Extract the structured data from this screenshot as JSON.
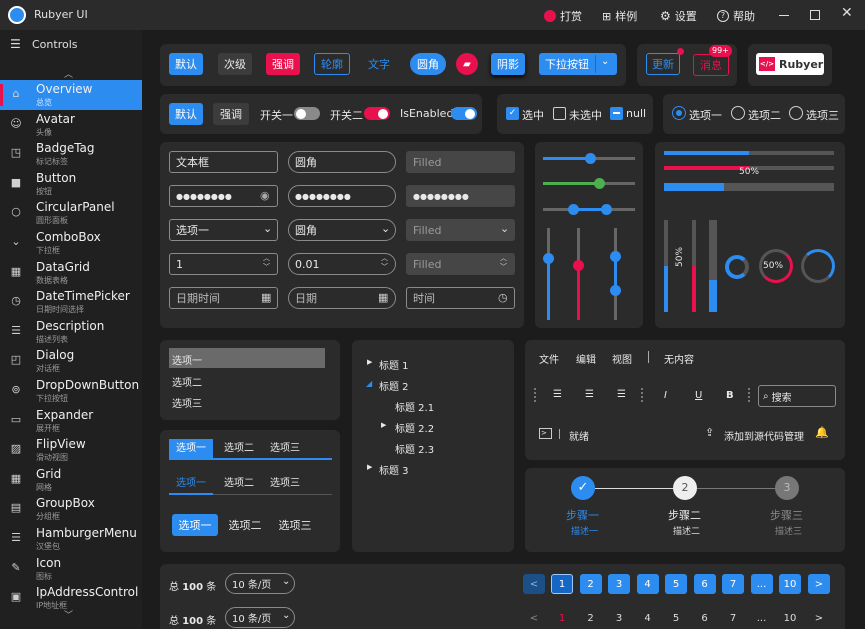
{
  "app": {
    "title": "Rubyer UI"
  },
  "titlebar": {
    "reward": "打赏",
    "samples": "样例",
    "settings": "设置",
    "help": "帮助"
  },
  "sidebar": {
    "header": "Controls",
    "items": [
      {
        "label": "Overview",
        "sub": "总览",
        "icon": "home-icon",
        "glyph": "⌂"
      },
      {
        "label": "Avatar",
        "sub": "头像",
        "icon": "avatar-icon",
        "glyph": "☺"
      },
      {
        "label": "BadgeTag",
        "sub": "标记标签",
        "icon": "badge-icon",
        "glyph": "◳"
      },
      {
        "label": "Button",
        "sub": "按钮",
        "icon": "button-icon",
        "glyph": "■"
      },
      {
        "label": "CircularPanel",
        "sub": "圆形面板",
        "icon": "circle-icon",
        "glyph": "○"
      },
      {
        "label": "ComboBox",
        "sub": "下拉框",
        "icon": "chevron-down-icon",
        "glyph": "⌄"
      },
      {
        "label": "DataGrid",
        "sub": "数据表格",
        "icon": "grid-icon",
        "glyph": "▦"
      },
      {
        "label": "DateTimePicker",
        "sub": "日期时间选择",
        "icon": "clock-icon",
        "glyph": "◷"
      },
      {
        "label": "Description",
        "sub": "描述列表",
        "icon": "list-icon",
        "glyph": "☰"
      },
      {
        "label": "Dialog",
        "sub": "对话框",
        "icon": "dialog-icon",
        "glyph": "◰"
      },
      {
        "label": "DropDownButton",
        "sub": "下拉按钮",
        "icon": "dropdown-icon",
        "glyph": "⊚"
      },
      {
        "label": "Expander",
        "sub": "展开框",
        "icon": "expander-icon",
        "glyph": "▭"
      },
      {
        "label": "FlipView",
        "sub": "滑动视图",
        "icon": "image-icon",
        "glyph": "▨"
      },
      {
        "label": "Grid",
        "sub": "网格",
        "icon": "grid-icon",
        "glyph": "▦"
      },
      {
        "label": "GroupBox",
        "sub": "分组框",
        "icon": "groupbox-icon",
        "glyph": "▤"
      },
      {
        "label": "HamburgerMenu",
        "sub": "汉堡包",
        "icon": "menu-icon",
        "glyph": "☰"
      },
      {
        "label": "Icon",
        "sub": "图标",
        "icon": "icon-icon",
        "glyph": "✎"
      },
      {
        "label": "IpAddressControl",
        "sub": "IP地址框",
        "icon": "ip-icon",
        "glyph": "▣"
      }
    ]
  },
  "buttons": {
    "default": "默认",
    "secondary": "次级",
    "emphasis": "强调",
    "outline": "轮廓",
    "text": "文字",
    "round": "圆角",
    "shadow": "阴影",
    "dropdown": "下拉按钮",
    "update": "更新",
    "message": "消息",
    "badge": "99+",
    "brand": "Rubyer"
  },
  "toggles": {
    "default": "默认",
    "emphasis": "强调",
    "switch1": "开关一",
    "switch2": "开关二",
    "enabled": "IsEnabled"
  },
  "checks": {
    "checked": "选中",
    "unchecked": "未选中",
    "null": "null"
  },
  "radios": [
    "选项一",
    "选项二",
    "选项三"
  ],
  "inputs": {
    "text": "文本框",
    "round": "圆角",
    "filled": "Filled",
    "pwd": "●●●●●●●●",
    "combo1": "选项一",
    "combo2": "圆角",
    "combo3": "Filled",
    "num1": "1",
    "num2": "0.01",
    "num3": "Filled",
    "datetime": "日期时间",
    "date": "日期",
    "time": "时间"
  },
  "progress": {
    "percent1": "50%",
    "percent2": "50%",
    "percent3": "50%",
    "value": 0.5
  },
  "listbox": [
    "选项一",
    "选项二",
    "选项三"
  ],
  "tree": {
    "n1": "标题 1",
    "n2": "标题 2",
    "n21": "标题 2.1",
    "n22": "标题 2.2",
    "n23": "标题 2.3",
    "n3": "标题 3"
  },
  "toolbar": {
    "file": "文件",
    "edit": "编辑",
    "view": "视图",
    "none": "无内容",
    "italic": "I",
    "underline": "U",
    "bold": "B",
    "search": "搜索",
    "ready": "就绪",
    "addsrc": "添加到源代码管理"
  },
  "tabs": [
    "选项一",
    "选项二",
    "选项三"
  ],
  "steps": [
    {
      "n": "1",
      "title": "步骤一",
      "desc": "描述一"
    },
    {
      "n": "2",
      "title": "步骤二",
      "desc": "描述二"
    },
    {
      "n": "3",
      "title": "步骤三",
      "desc": "描述三"
    }
  ],
  "pager": {
    "total_prefix": "总",
    "total": "100",
    "total_suffix": "条",
    "size": "10  条/页",
    "pages": [
      "1",
      "2",
      "3",
      "4",
      "5",
      "6",
      "7",
      "...",
      "10"
    ],
    "prev": "<",
    "next": ">"
  },
  "colors": {
    "accent": "#2d8cf0",
    "danger": "#e8114d",
    "success": "#4caf50"
  }
}
